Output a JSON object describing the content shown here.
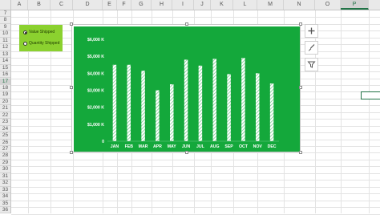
{
  "sheet": {
    "columns": [
      "A",
      "B",
      "C",
      "D",
      "E",
      "F",
      "G",
      "H",
      "I",
      "J",
      "K",
      "L",
      "M",
      "N",
      "O",
      "P"
    ],
    "active_column": "P",
    "rows": [
      "7",
      "8",
      "9",
      "10",
      "11",
      "12",
      "13",
      "14",
      "15",
      "16",
      "17",
      "18",
      "19",
      "20",
      "21",
      "22",
      "23",
      "24",
      "25",
      "26",
      "27",
      "28",
      "29",
      "30",
      "31",
      "32",
      "33",
      "34",
      "35",
      "36"
    ],
    "active_row": "17"
  },
  "option_panel": {
    "options": [
      {
        "label": "Value Shipped",
        "selected": true
      },
      {
        "label": "Quantity Shipped",
        "selected": false
      }
    ]
  },
  "chart_data": {
    "type": "bar",
    "categories": [
      "JAN",
      "FEB",
      "MAR",
      "APR",
      "MAY",
      "JUN",
      "JUL",
      "AUG",
      "SEP",
      "OCT",
      "NOV",
      "DEC"
    ],
    "values": [
      4500,
      4500,
      4150,
      3000,
      3350,
      4800,
      4450,
      4850,
      3950,
      4900,
      4000,
      3400
    ],
    "ylim": [
      0,
      6000
    ],
    "tick_labels": [
      "0",
      "$1,000 K",
      "$2,000 K",
      "$3,000 K",
      "$4,000 K",
      "$5,000 K",
      "$6,000 K"
    ],
    "title": "",
    "xlabel": "",
    "ylabel": "",
    "grid": false,
    "legend": "none",
    "colors": {
      "background": "#14a83b",
      "bar": "#ffffff",
      "bar_stripe": "#6cc886",
      "text": "#ffffff"
    }
  },
  "chart_tools": {
    "buttons": [
      {
        "name": "chart-elements",
        "glyph": "+"
      },
      {
        "name": "chart-styles",
        "glyph": "brush"
      },
      {
        "name": "chart-filters",
        "glyph": "filter"
      }
    ]
  },
  "colors": {
    "excel_green": "#217346",
    "panel_green": "#8bd12f"
  }
}
